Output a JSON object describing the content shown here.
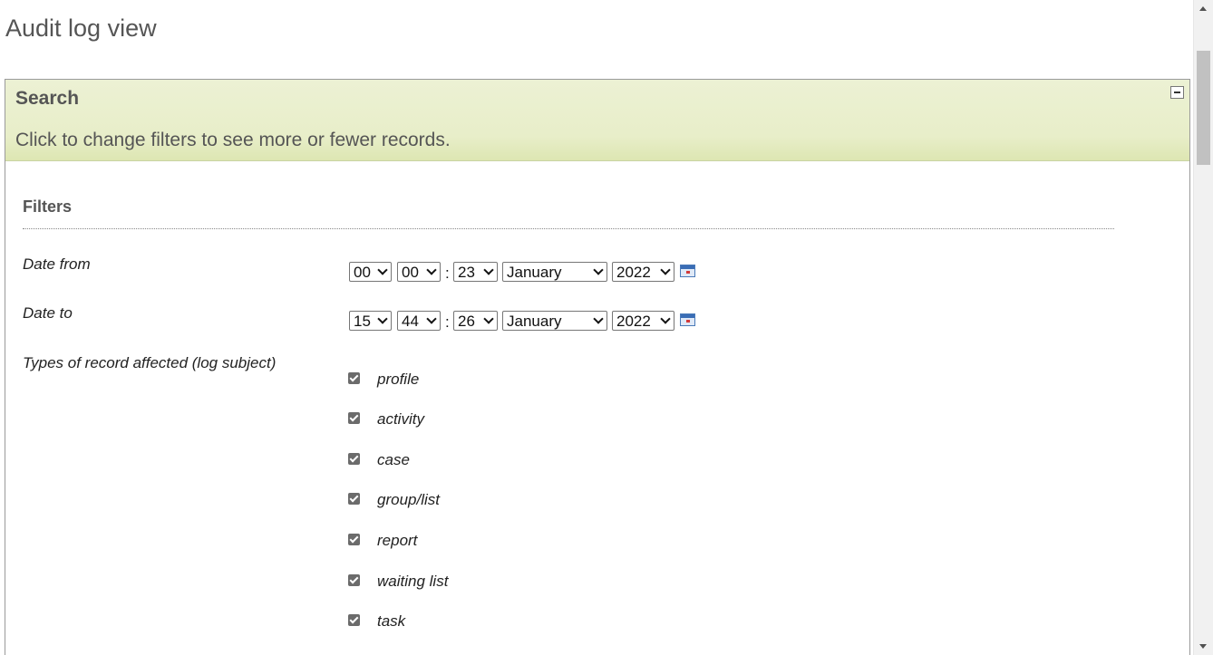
{
  "page": {
    "title": "Audit log view"
  },
  "search_panel": {
    "title": "Search",
    "description": "Click to change filters to see more or fewer records.",
    "collapse_icon": "minus-icon"
  },
  "filters": {
    "heading": "Filters",
    "date_from": {
      "label": "Date from",
      "hour": "00",
      "minute": "00",
      "separator": ":",
      "day": "23",
      "month": "January",
      "year": "2022",
      "calendar_icon": "calendar-icon"
    },
    "date_to": {
      "label": "Date to",
      "hour": "15",
      "minute": "44",
      "separator": ":",
      "day": "26",
      "month": "January",
      "year": "2022",
      "calendar_icon": "calendar-icon"
    },
    "record_types": {
      "label": "Types of record affected (log subject)",
      "items": [
        {
          "label": "profile",
          "checked": true
        },
        {
          "label": "activity",
          "checked": true
        },
        {
          "label": "case",
          "checked": true
        },
        {
          "label": "group/list",
          "checked": true
        },
        {
          "label": "report",
          "checked": true
        },
        {
          "label": "waiting list",
          "checked": true
        },
        {
          "label": "task",
          "checked": true
        }
      ]
    }
  },
  "colors": {
    "header_bg": "#e8eec9",
    "border": "#9a9a9a",
    "text": "#555555"
  }
}
